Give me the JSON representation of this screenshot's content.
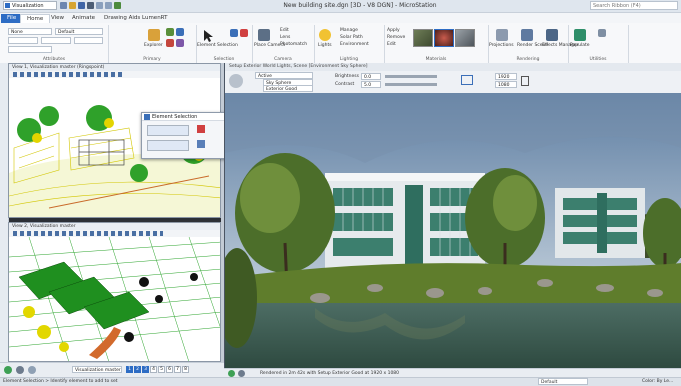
{
  "app": {
    "workflow": "Visualization",
    "window_title": "New building site.dgn [3D - V8 DGN] - MicroStation",
    "search_placeholder": "Search Ribbon (F4)"
  },
  "tabs": [
    "File",
    "Home",
    "View",
    "Animate",
    "Drawing Aids",
    "LumenRT"
  ],
  "active_tab": "Home",
  "ribbon": {
    "attributes": {
      "level": "None",
      "style": "Default",
      "label": "Attributes"
    },
    "primary_label": "Primary",
    "explorer": "Explorer",
    "element_selection": "Element Selection",
    "selection_label": "Selection",
    "place_camera": "Place Camera",
    "camera_items": [
      "Edit",
      "Lens",
      "Photomatch"
    ],
    "camera_label": "Camera",
    "lights": "Lights",
    "lighting_items": [
      "Manage",
      "Solar Path",
      "Environment"
    ],
    "lighting_label": "Lighting",
    "material_items": [
      "Apply",
      "Remove",
      "Edit"
    ],
    "materials_label": "Materials",
    "projections": "Projections",
    "render_scene": "Render Scene",
    "effects_manager": "Effects Manager",
    "rendering_label": "Rendering",
    "populate": "Populate",
    "utilities_label": "Utilities"
  },
  "views": {
    "view1_title": "View 1, Visualization master (Ringspoint)",
    "view2_title": "View 2, Visualization master"
  },
  "dialog": {
    "title": "Element Selection"
  },
  "render_window": {
    "title": "Setup Exterior World Lights, Scene [Environment Sky Sphere]",
    "light_setup": "Active",
    "environment": "Sky Sphere",
    "preset": "Exterior Good",
    "brightness_label": "Brightness",
    "brightness_value": "0.0",
    "contrast_label": "Contrast",
    "contrast_value": "5.0",
    "width_value": "1920",
    "height_value": "1080",
    "status": "Rendered in 2m 42s with Setup Exterior Good at 1920 x 1080"
  },
  "view_controls": {
    "model": "Visualization master",
    "view_numbers": [
      "1",
      "2",
      "3",
      "4",
      "5",
      "6",
      "7",
      "8"
    ]
  },
  "statusbar": {
    "prompt": "Element Selection > Identify element to add to set",
    "level": "Default",
    "right_text": "Color: By Le..."
  },
  "colors": {
    "accent": "#2d6cc4",
    "ribbon_bg": "#f7f8fa",
    "title_bg": "#dfe6ee",
    "sky_top": "#5f7fa3",
    "grass": "#5f7d2c",
    "water": "#3d6156"
  }
}
